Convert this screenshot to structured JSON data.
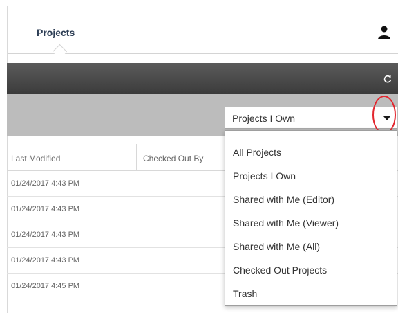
{
  "header": {
    "tab_label": "Projects"
  },
  "icons": {
    "user": "user-icon",
    "refresh": "refresh-icon",
    "caret": "caret-down-icon"
  },
  "filter": {
    "selected": "Projects I Own",
    "options": [
      "All Projects",
      "Projects I Own",
      "Shared with Me (Editor)",
      "Shared with Me (Viewer)",
      "Shared with Me (All)",
      "Checked Out Projects",
      "Trash"
    ]
  },
  "table": {
    "columns": [
      "Last Modified",
      "Checked Out By"
    ],
    "rows": [
      {
        "last_modified": "01/24/2017 4:43 PM"
      },
      {
        "last_modified": "01/24/2017 4:43 PM"
      },
      {
        "last_modified": "01/24/2017 4:43 PM"
      },
      {
        "last_modified": "01/24/2017 4:43 PM"
      },
      {
        "last_modified": "01/24/2017 4:45 PM"
      }
    ]
  },
  "colors": {
    "tab_text": "#2d3e55",
    "toolbar": "#4a4a4a",
    "filter_bar": "#bcbcbc",
    "highlight_circle": "#e3262e"
  }
}
